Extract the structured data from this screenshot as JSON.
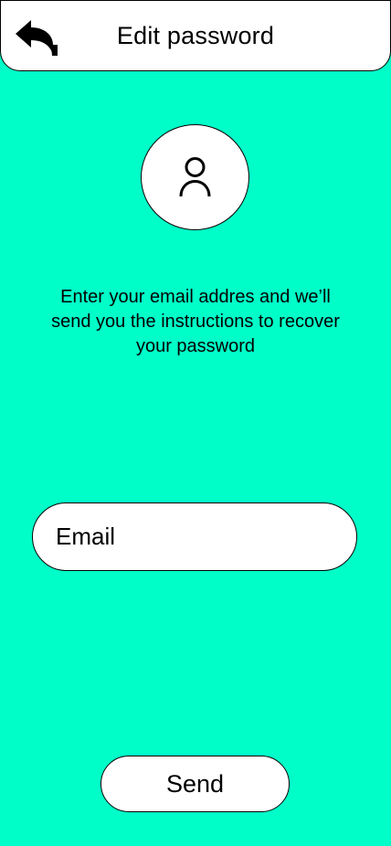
{
  "header": {
    "title": "Edit password",
    "back_icon": "back-arrow-icon"
  },
  "avatar": {
    "icon": "user-icon"
  },
  "instructions": {
    "text": "Enter your email addres and we’ll send you the instructions to recover your password"
  },
  "email_field": {
    "placeholder": "Email",
    "value": ""
  },
  "send_button": {
    "label": "Send"
  },
  "colors": {
    "background": "#00FFC8",
    "surface": "#FFFFFF",
    "outline": "#000000"
  }
}
